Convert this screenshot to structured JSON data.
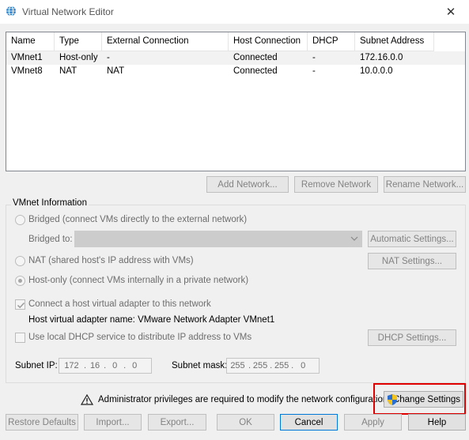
{
  "window": {
    "title": "Virtual Network Editor",
    "close_glyph": "✕"
  },
  "table": {
    "columns": [
      "Name",
      "Type",
      "External Connection",
      "Host Connection",
      "DHCP",
      "Subnet Address"
    ],
    "rows": [
      [
        "VMnet1",
        "Host-only",
        "-",
        "Connected",
        "-",
        "172.16.0.0"
      ],
      [
        "VMnet8",
        "NAT",
        "NAT",
        "Connected",
        "-",
        "10.0.0.0"
      ]
    ],
    "selected_row": 0
  },
  "network_buttons": {
    "add": "Add Network...",
    "remove": "Remove Network",
    "rename": "Rename Network..."
  },
  "vmnet_info": {
    "group_label": "VMnet Information",
    "bridged_label": "Bridged (connect VMs directly to the external network)",
    "bridged_to_label": "Bridged to:",
    "bridged_to_value": "",
    "automatic_settings": "Automatic Settings...",
    "nat_label": "NAT (shared host's IP address with VMs)",
    "nat_settings": "NAT Settings...",
    "hostonly_label": "Host-only (connect VMs internally in a private network)",
    "selected_mode": "host-only",
    "connect_adapter_label": "Connect a host virtual adapter to this network",
    "connect_adapter_checked": true,
    "adapter_name_label": "Host virtual adapter name: VMware Network Adapter VMnet1",
    "dhcp_label": "Use local DHCP service to distribute IP address to VMs",
    "dhcp_checked": false,
    "dhcp_settings": "DHCP Settings...",
    "subnet_ip_label": "Subnet IP:",
    "subnet_ip": [
      "172",
      "16",
      "0",
      "0"
    ],
    "subnet_mask_label": "Subnet mask:",
    "subnet_mask": [
      "255",
      "255",
      "255",
      "0"
    ]
  },
  "admin": {
    "warning_text": "Administrator privileges are required to modify the network configuration.",
    "change_settings": "Change Settings"
  },
  "bottom_buttons": {
    "restore": "Restore Defaults",
    "import": "Import...",
    "export": "Export...",
    "ok": "OK",
    "cancel": "Cancel",
    "apply": "Apply",
    "help": "Help"
  },
  "colors": {
    "highlight": "#e00000",
    "selected_row": "#f2f2f2",
    "focus_border": "#0078d7"
  },
  "icons": {
    "title": "network-globe-icon",
    "warning": "warning-triangle-icon",
    "shield": "uac-shield-icon"
  }
}
